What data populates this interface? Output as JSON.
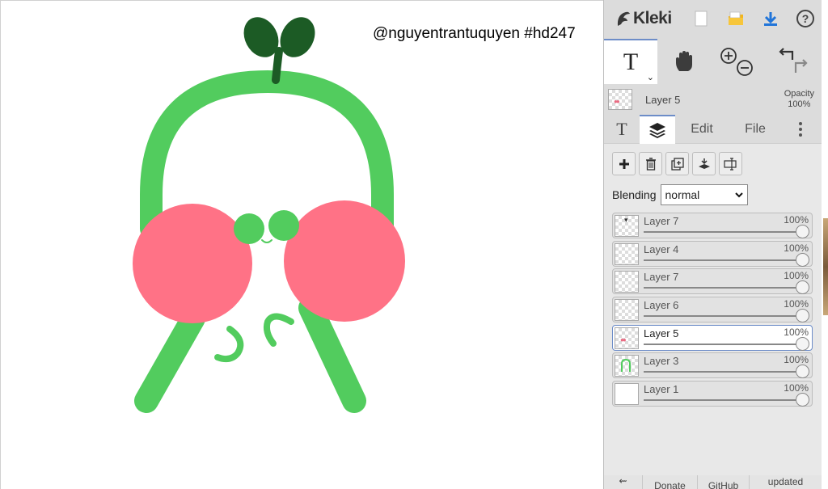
{
  "canvas": {
    "watermark": "@nguyentrantuquyen #hd247",
    "colors": {
      "green": "#52cc5e",
      "pink": "#ff7286",
      "sprout": "#1c5b25"
    }
  },
  "app": {
    "name": "Kleki",
    "top_icons": [
      "new-image-icon",
      "open-folder-icon",
      "download-icon",
      "help-icon"
    ],
    "tools": [
      "text-tool",
      "hand-tool",
      "zoom-tools",
      "undo-redo-tools"
    ],
    "current_layer": {
      "name": "Layer 5",
      "opacity_label": "Opacity",
      "opacity_value": "100%"
    },
    "tabs": {
      "edit": "Edit",
      "file": "File"
    },
    "layer_buttons": [
      "add-layer-icon",
      "delete-layer-icon",
      "duplicate-layer-icon",
      "merge-down-icon",
      "rename-layer-icon"
    ],
    "blending": {
      "label": "Blending",
      "value": "normal"
    },
    "layers": [
      {
        "name": "Layer 7",
        "opacity": "100%",
        "selected": false
      },
      {
        "name": "Layer 4",
        "opacity": "100%",
        "selected": false
      },
      {
        "name": "Layer 7",
        "opacity": "100%",
        "selected": false
      },
      {
        "name": "Layer 6",
        "opacity": "100%",
        "selected": false
      },
      {
        "name": "Layer 5",
        "opacity": "100%",
        "selected": true
      },
      {
        "name": "Layer 3",
        "opacity": "100%",
        "selected": false
      },
      {
        "name": "Layer 1",
        "opacity": "100%",
        "selected": false
      }
    ],
    "footer": {
      "back": "⇜",
      "donate": "Donate",
      "github": "GitHub",
      "updated": "updated"
    },
    "accent": "#6d8dc8"
  }
}
